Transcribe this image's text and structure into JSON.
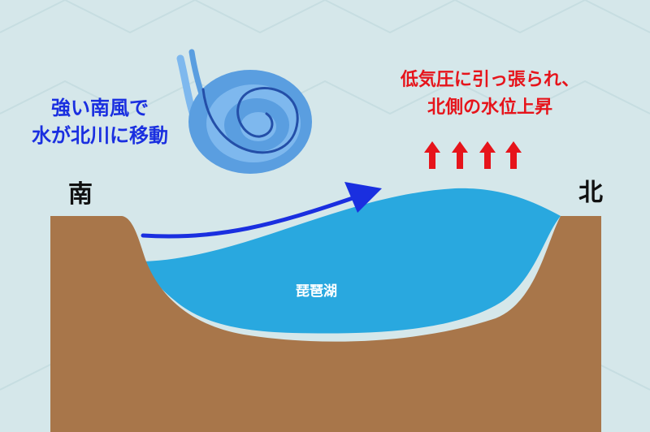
{
  "wind_caption": {
    "line1": "強い南風で",
    "line2": "水が北川に移動"
  },
  "pressure_caption": {
    "line1": "低気圧に引っ張られ、",
    "line2": "北側の水位上昇"
  },
  "directions": {
    "south": "南",
    "north": "北"
  },
  "lake_label": "琵琶湖",
  "colors": {
    "background": "#d5e7ea",
    "ground": "#a8764a",
    "water": "#29a8df",
    "wind_arrow": "#1a2fe0",
    "rise_arrows": "#e6141b",
    "typhoon": "#5a9ee0"
  },
  "icons": {
    "typhoon": "typhoon-swirl-icon",
    "rise": "up-arrow-icon"
  }
}
